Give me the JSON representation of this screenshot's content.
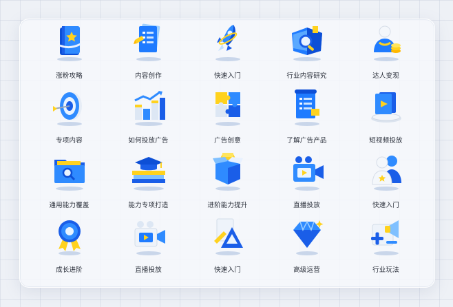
{
  "colors": {
    "primary_blue": "#1a73f0",
    "accent_yellow": "#ffd21e",
    "panel_bg": "#f7f9fc"
  },
  "items": [
    {
      "label": "涨粉攻略",
      "icon": "star-book-icon"
    },
    {
      "label": "内容创作",
      "icon": "document-pen-icon"
    },
    {
      "label": "快速入门",
      "icon": "rocket-icon"
    },
    {
      "label": "行业内容研究",
      "icon": "book-magnifier-icon"
    },
    {
      "label": "达人变现",
      "icon": "person-coins-icon"
    },
    {
      "label": "专项内容",
      "icon": "target-dart-icon"
    },
    {
      "label": "如何投放广告",
      "icon": "bar-chart-growth-icon"
    },
    {
      "label": "广告创意",
      "icon": "puzzle-icon"
    },
    {
      "label": "了解广告产品",
      "icon": "scroll-list-icon"
    },
    {
      "label": "短视频投放",
      "icon": "video-cards-icon"
    },
    {
      "label": "通用能力覆盖",
      "icon": "folder-search-icon"
    },
    {
      "label": "能力专项打造",
      "icon": "graduation-cap-books-icon"
    },
    {
      "label": "进阶能力提升",
      "icon": "open-box-icon"
    },
    {
      "label": "直播投放",
      "icon": "video-camera-icon"
    },
    {
      "label": "快速入门",
      "icon": "user-group-icon"
    },
    {
      "label": "成长进阶",
      "icon": "award-medal-icon"
    },
    {
      "label": "直播投放",
      "icon": "video-camera-icon"
    },
    {
      "label": "快速入门",
      "icon": "triangle-ruler-icon"
    },
    {
      "label": "高级运营",
      "icon": "diamond-icon"
    },
    {
      "label": "行业玩法",
      "icon": "megaphone-plus-icon"
    }
  ]
}
